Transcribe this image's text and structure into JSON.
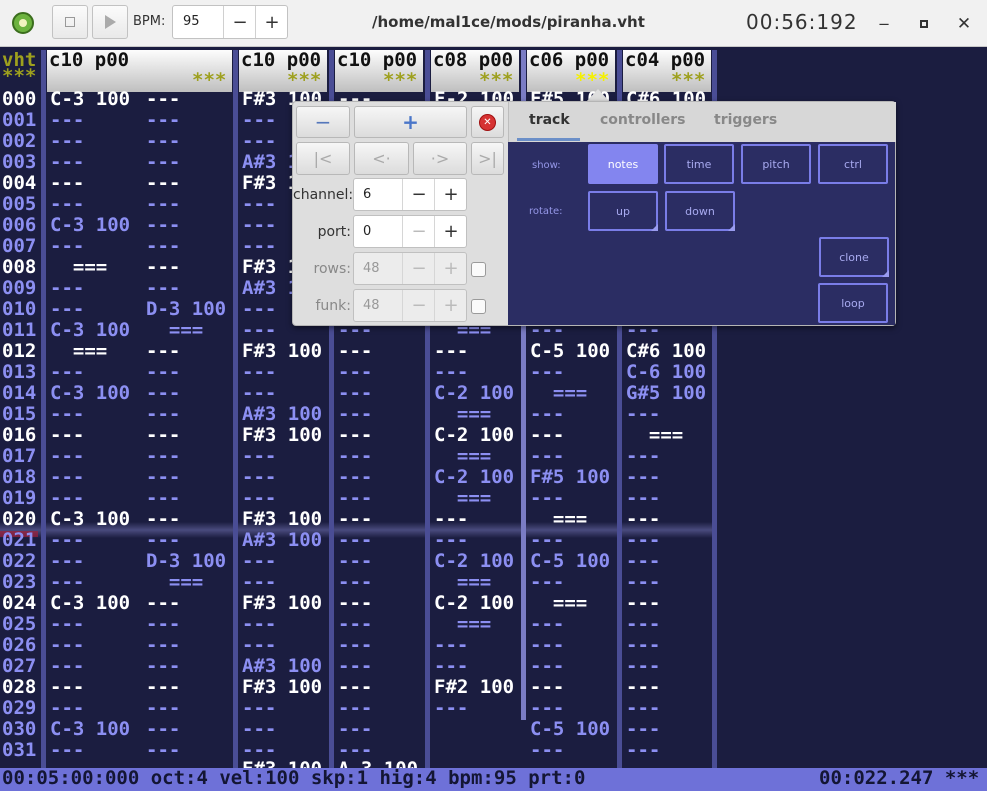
{
  "titlebar": {
    "bpm_label": "BPM:",
    "bpm_value": "95",
    "file_path": "/home/mal1ce/mods/piranha.vht",
    "time": "00:56:192",
    "icons": [
      "app-logo-icon",
      "stop-icon",
      "play-icon",
      "minus-icon",
      "plus-icon",
      "minimize-icon",
      "maximize-icon",
      "close-icon"
    ]
  },
  "tracker": {
    "index_header": "vht",
    "index_stars": "***",
    "row_numbers": [
      "000",
      "001",
      "002",
      "003",
      "004",
      "005",
      "006",
      "007",
      "008",
      "009",
      "010",
      "011",
      "012",
      "013",
      "014",
      "015",
      "016",
      "017",
      "018",
      "019",
      "020",
      "021",
      "022",
      "023",
      "024",
      "025",
      "026",
      "027",
      "028",
      "029",
      "030",
      "031"
    ],
    "tracks": [
      {
        "header": "c10 p00",
        "stars": "***"
      },
      {
        "header": "c10 p00",
        "stars": "***"
      },
      {
        "header": "c10 p00",
        "stars": "***"
      },
      {
        "header": "c08 p00",
        "stars": "***"
      },
      {
        "header": "c06 p00",
        "stars": "***"
      },
      {
        "header": "c04 p00",
        "stars": "***"
      }
    ],
    "cells": {
      "t1a": [
        "C-3 100",
        "---",
        "---",
        "---",
        "---",
        "---",
        "C-3 100",
        "---",
        "  ===",
        "---",
        "---",
        "C-3 100",
        "  ===",
        "---",
        "C-3 100",
        "---",
        "---",
        "---",
        "---",
        "---",
        "C-3 100",
        "---",
        "---",
        "---",
        "C-3 100",
        "---",
        "---",
        "---",
        "---",
        "---",
        "C-3 100",
        "---"
      ],
      "t1b": [
        "---",
        "---",
        "---",
        "---",
        "---",
        "---",
        "---",
        "---",
        "---",
        "---",
        "D-3 100",
        "  ===",
        "---",
        "---",
        "---",
        "---",
        "---",
        "---",
        "---",
        "---",
        "---",
        "---",
        "D-3 100",
        "  ===",
        "---",
        "---",
        "---",
        "---",
        "---",
        "---",
        "---",
        "---"
      ],
      "t2a": [
        "F#3 100",
        "---",
        "---",
        "A#3 100",
        "F#3 100",
        "---",
        "---",
        "---",
        "F#3 100",
        "A#3 100",
        "---",
        "---",
        "F#3 100",
        "---",
        "---",
        "A#3 100",
        "F#3 100",
        "---",
        "---",
        "---",
        "F#3 100",
        "A#3 100",
        "---",
        "---",
        "F#3 100",
        "---",
        "---",
        "A#3 100",
        "F#3 100",
        "---",
        "---",
        "---"
      ],
      "t3a": [
        "---",
        "---",
        "---",
        "---",
        "---",
        "---",
        "---",
        "---",
        "---",
        "---",
        "---",
        "---",
        "---",
        "---",
        "---",
        "---",
        "---",
        "---",
        "---",
        "---",
        "---",
        "---",
        "---",
        "---",
        "---",
        "---",
        "---",
        "---",
        "---",
        "---",
        "---",
        "---"
      ],
      "t4a": [
        "F-2 100",
        "---",
        "---",
        "---",
        "---",
        "---",
        "---",
        "---",
        "---",
        "---",
        "---",
        "  ===",
        "---",
        "---",
        "C-2 100",
        "  ===",
        "C-2 100",
        "  ===",
        "C-2 100",
        "  ===",
        "---",
        "---",
        "C-2 100",
        "  ===",
        "C-2 100",
        "  ===",
        "---",
        "---",
        "F#2 100",
        "---",
        "",
        ""
      ],
      "t5a": [
        "F#5 100",
        "---",
        "---",
        "---",
        "---",
        "---",
        "---",
        "---",
        "---",
        "---",
        "---",
        "---",
        "C-5 100",
        "---",
        "  ===",
        "---",
        "---",
        "---",
        "F#5 100",
        "---",
        "  ===",
        "---",
        "C-5 100",
        "---",
        "  ===",
        "---",
        "---",
        "---",
        "---",
        "---",
        "C-5 100",
        "---"
      ],
      "t6a": [
        "C#6 100",
        "---",
        "---",
        "---",
        "---",
        "---",
        "---",
        "---",
        "---",
        "---",
        "---",
        "---",
        "C#6 100",
        "C-6 100",
        "G#5 100",
        "---",
        "  ===",
        "---",
        "---",
        "---",
        "---",
        "---",
        "---",
        "---",
        "---",
        "---",
        "---",
        "---",
        "---",
        "---",
        "---",
        "---"
      ]
    },
    "partial_bottom_row": [
      "---",
      "---",
      "F#3 100",
      "A-3 100"
    ]
  },
  "popover": {
    "channel_label": "channel:",
    "channel_value": "6",
    "port_label": "port:",
    "port_value": "0",
    "rows_label": "rows:",
    "rows_value": "48",
    "funk_label": "funk:",
    "funk_value": "48",
    "tabs": [
      "track",
      "controllers",
      "triggers"
    ],
    "active_tab": "track",
    "show_label": "show:",
    "show_buttons": [
      "notes",
      "time",
      "pitch",
      "ctrl"
    ],
    "show_active": "notes",
    "rotate_label": "rotate:",
    "rotate_buttons": [
      "up",
      "down"
    ],
    "clone_label": "clone",
    "loop_label": "loop"
  },
  "statusbar": {
    "left": "00:05:00:000 oct:4 vel:100 skp:1 hig:4 bpm:95 prt:0",
    "right": "00:022.247 ***"
  }
}
